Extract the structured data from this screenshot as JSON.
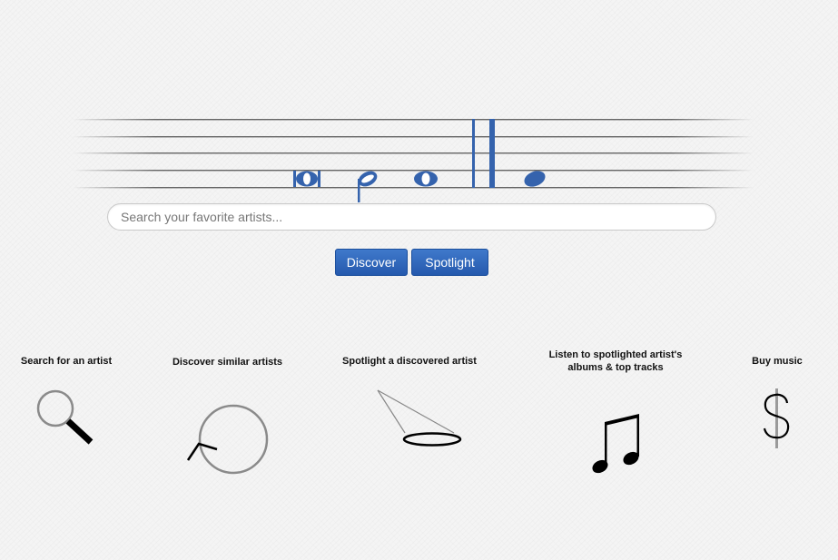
{
  "search": {
    "placeholder": "Search your favorite artists..."
  },
  "buttons": {
    "discover_label": "Discover",
    "spotlight_label": "Spotlight"
  },
  "steps": [
    {
      "label": "Search for an artist",
      "icon": "magnifier-icon"
    },
    {
      "label": "Discover similar artists",
      "icon": "circle-arrow-icon"
    },
    {
      "label": "Spotlight a discovered artist",
      "icon": "spotlight-icon"
    },
    {
      "label": "Listen to spotlighted artist's albums & top tracks",
      "icon": "music-note-icon"
    },
    {
      "label": "Buy music",
      "icon": "dollar-icon"
    }
  ],
  "colors": {
    "accent": "#2d62b5",
    "note": "#3563ad",
    "staff_line": "#555555"
  }
}
